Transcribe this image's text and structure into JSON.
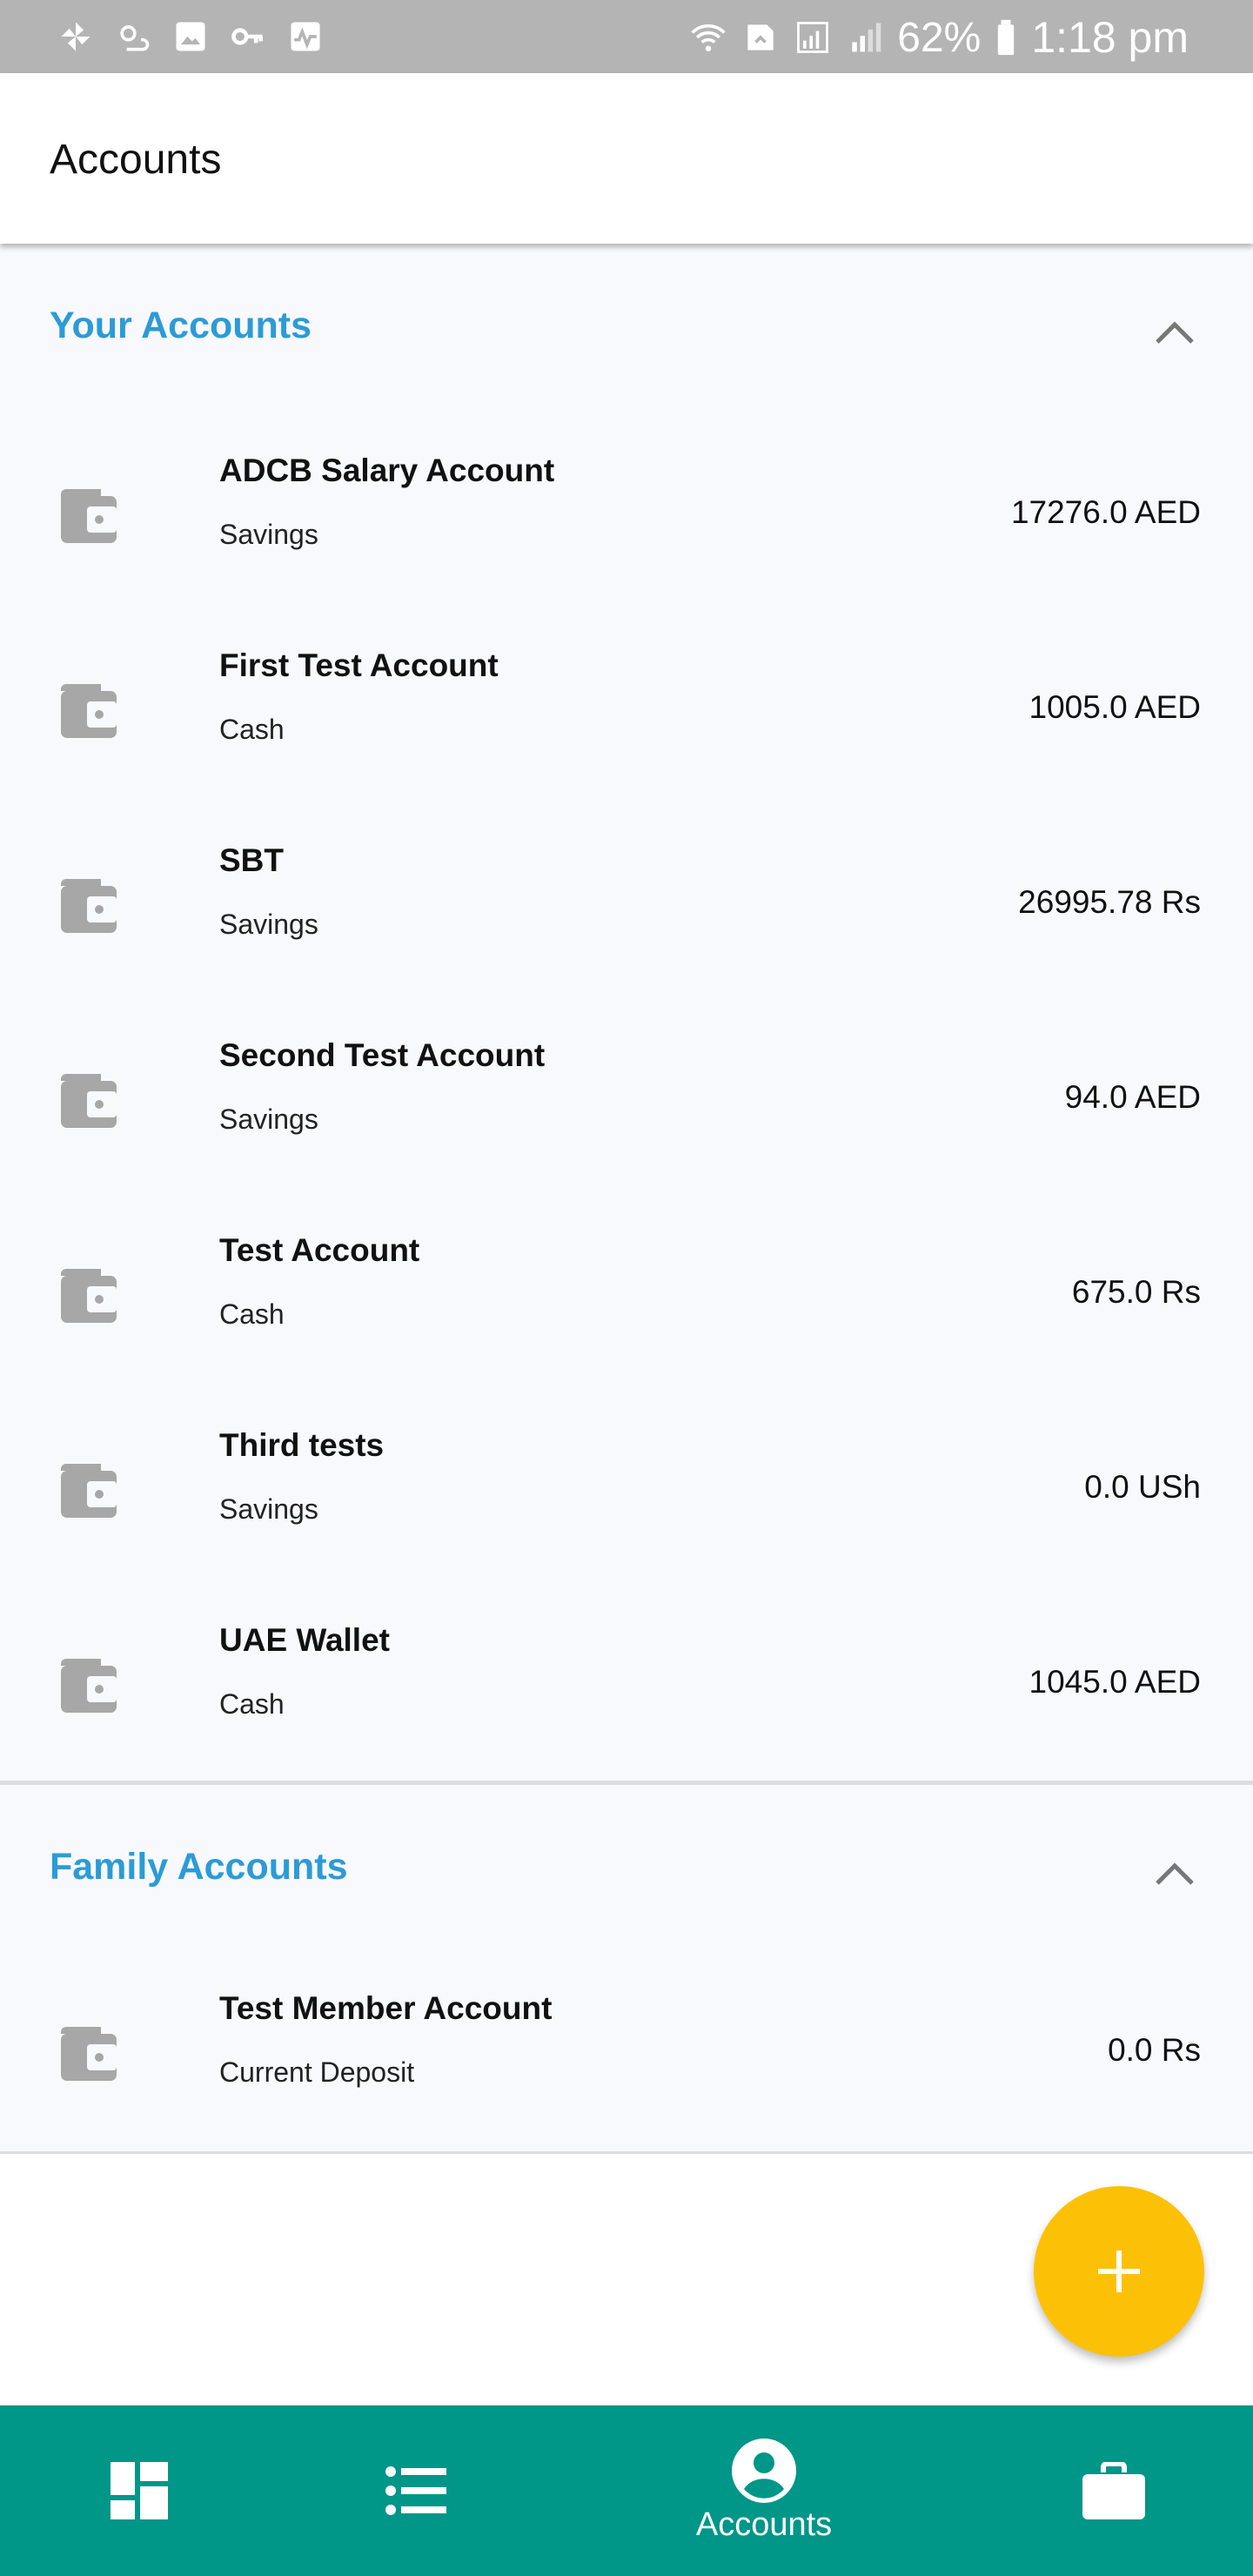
{
  "status_bar": {
    "battery": "62%",
    "time": "1:18 pm",
    "left_icons": [
      "pinwheel-icon",
      "weather-icon",
      "image-icon",
      "key-icon",
      "activity-icon"
    ],
    "right_icons": [
      "wifi-icon",
      "nfc-icon",
      "signal-icon",
      "signal-r-icon",
      "battery-icon"
    ]
  },
  "app_bar": {
    "title": "Accounts"
  },
  "sections": [
    {
      "title": "Your Accounts",
      "accounts": [
        {
          "name": "ADCB Salary Account",
          "type": "Savings",
          "amount": "17276.0 AED"
        },
        {
          "name": "First Test Account",
          "type": "Cash",
          "amount": "1005.0 AED"
        },
        {
          "name": "SBT",
          "type": "Savings",
          "amount": "26995.78 Rs"
        },
        {
          "name": "Second Test Account",
          "type": "Savings",
          "amount": "94.0 AED"
        },
        {
          "name": "Test Account",
          "type": "Cash",
          "amount": "675.0 Rs"
        },
        {
          "name": "Third tests",
          "type": "Savings",
          "amount": "0.0 USh"
        },
        {
          "name": "UAE Wallet",
          "type": "Cash",
          "amount": "1045.0 AED"
        }
      ]
    },
    {
      "title": "Family Accounts",
      "accounts": [
        {
          "name": "Test Member Account",
          "type": "Current Deposit",
          "amount": "0.0 Rs"
        }
      ]
    }
  ],
  "bottom_nav": {
    "items": [
      {
        "icon": "dashboard-icon",
        "label": ""
      },
      {
        "icon": "list-icon",
        "label": ""
      },
      {
        "icon": "account-circle-icon",
        "label": "Accounts"
      },
      {
        "icon": "briefcase-icon",
        "label": ""
      }
    ]
  },
  "colors": {
    "status_bar": "#b4b4b4",
    "section_title": "#2c9bd6",
    "fab": "#fcc107",
    "bottom_nav": "#009688",
    "content_bg": "#f8f9fd",
    "wallet_icon": "#a7a7a7"
  }
}
